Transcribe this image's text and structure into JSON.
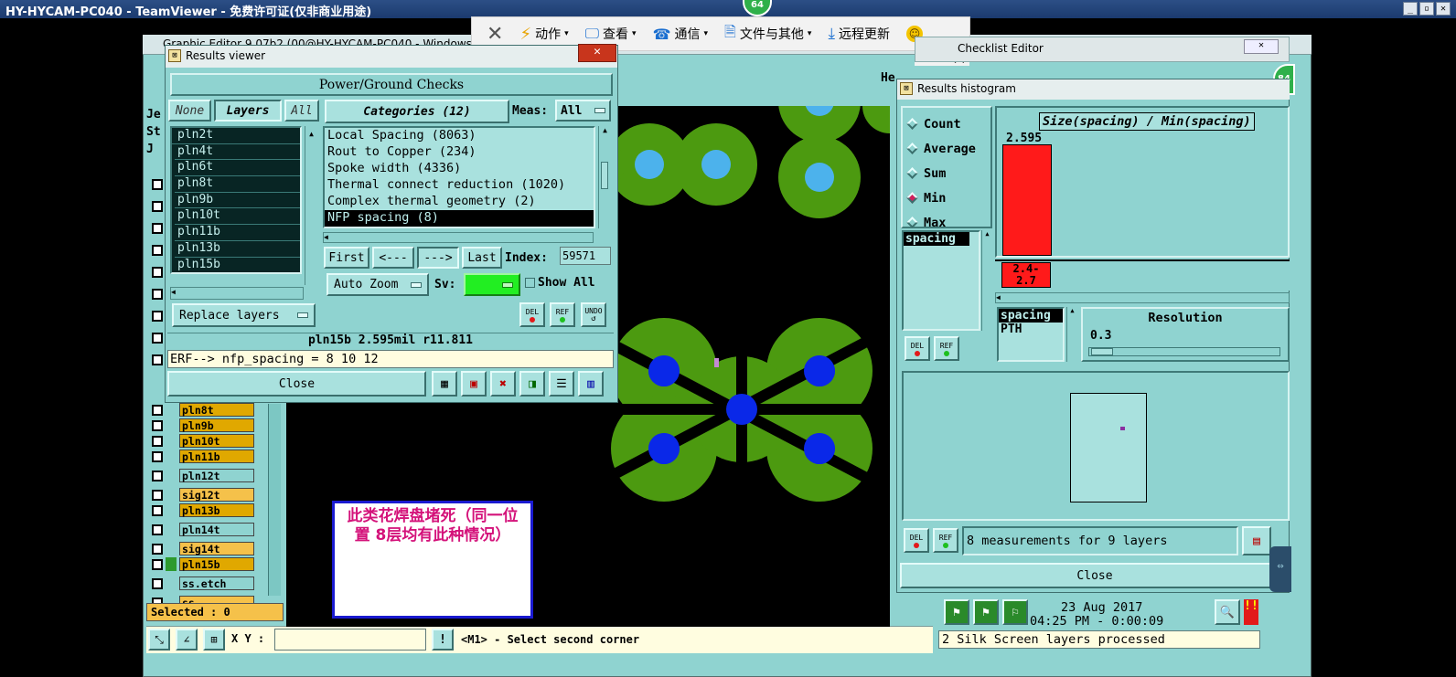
{
  "teamviewer": {
    "title": "HY-HYCAM-PC040 - TeamViewer - 免费许可证(仅非商业用途)",
    "session_badge": "64",
    "toolbar": {
      "close_icon": "close-icon",
      "action_label": "动作",
      "view_label": "查看",
      "comm_label": "通信",
      "files_label": "文件与其他",
      "update_label": "远程更新"
    }
  },
  "graphic_editor": {
    "title": "Graphic Editor 9.07b2 (00@HY-HYCAM-PC040 - Windows",
    "selected_label": "Selected : 0",
    "xy_label": "X Y :",
    "xy_value": "",
    "status_msg": "<M1> - Select second corner",
    "left_letters": [
      "Je",
      "St",
      "J"
    ],
    "layers_panel": [
      {
        "name": "pln8t",
        "color": "#e0a800"
      },
      {
        "name": "pln9b",
        "color": "#e0a800"
      },
      {
        "name": "pln10t",
        "color": "#e0a800"
      },
      {
        "name": "pln11b",
        "color": "#e0a800"
      },
      {
        "name": "pln12t",
        "color": "#8fd3d0"
      },
      {
        "name": "sig12t",
        "color": "#f5c14a"
      },
      {
        "name": "pln13b",
        "color": "#e0a800"
      },
      {
        "name": "pln14t",
        "color": "#8fd3d0"
      },
      {
        "name": "sig14t",
        "color": "#f5c14a"
      },
      {
        "name": "pln15b",
        "color": "#e0a800"
      },
      {
        "name": "ss.etch",
        "color": "#8fd3d0"
      },
      {
        "name": "ss",
        "color": "#f5c14a"
      }
    ]
  },
  "results_viewer": {
    "title": "Results viewer",
    "header": "Power/Ground Checks",
    "none_btn": "None",
    "layers_btn": "Layers",
    "all_btn": "All",
    "categories_btn": "Categories (12)",
    "meas_label": "Meas:",
    "meas_value": "All",
    "layers": [
      "pln2t",
      "pln4t",
      "pln6t",
      "pln8t",
      "pln9b",
      "pln10t",
      "pln11b",
      "pln13b",
      "pln15b"
    ],
    "categories": [
      "Local Spacing (8063)",
      "Rout to Copper (234)",
      "Spoke width (4336)",
      "Thermal connect reduction (1020)",
      "Complex thermal geometry (2)",
      "NFP spacing (8)"
    ],
    "selected_category_index": 5,
    "first_btn": "First",
    "prev_btn": "<---",
    "next_btn": "--->",
    "last_btn": "Last",
    "index_label": "Index:",
    "index_value": "59571",
    "auto_zoom": "Auto Zoom",
    "sv_label": "Sv:",
    "show_all": "Show All",
    "replace_layers": "Replace layers",
    "del_btn": "DEL",
    "ref_btn": "REF",
    "undo_btn": "UNDO",
    "info_line": "pln15b 2.595mil  r11.811",
    "erf_line": "ERF--> nfp_spacing = 8 10 12",
    "close_btn": "Close"
  },
  "annotation": {
    "text": "此类花焊盘堵死（同一位置  8层均有此种情况）"
  },
  "checklist_editor": {
    "title": "Checklist Editor",
    "partial_text": "He",
    "badge": "84"
  },
  "histogram": {
    "title": "Results histogram",
    "radio_options": [
      "Count",
      "Average",
      "Sum",
      "Min",
      "Max"
    ],
    "selected_option": "Min",
    "chart_title": "Size(spacing) / Min(spacing)",
    "bar_value": "2.595",
    "bar_label_line1": "2.4-",
    "bar_label_line2": "2.7",
    "list1": [
      "spacing"
    ],
    "list2": [
      "spacing",
      "PTH"
    ],
    "resolution_label": "Resolution",
    "resolution_value": "0.3",
    "del_btn": "DEL",
    "ref_btn": "REF",
    "measurements": "8 measurements for 9 layers",
    "close_btn": "Close",
    "bar_color": "#ff1a1a"
  },
  "status_area": {
    "date": "23 Aug 2017",
    "time": "04:25 PM - 0:00:09",
    "message": "2 Silk Screen layers processed"
  }
}
